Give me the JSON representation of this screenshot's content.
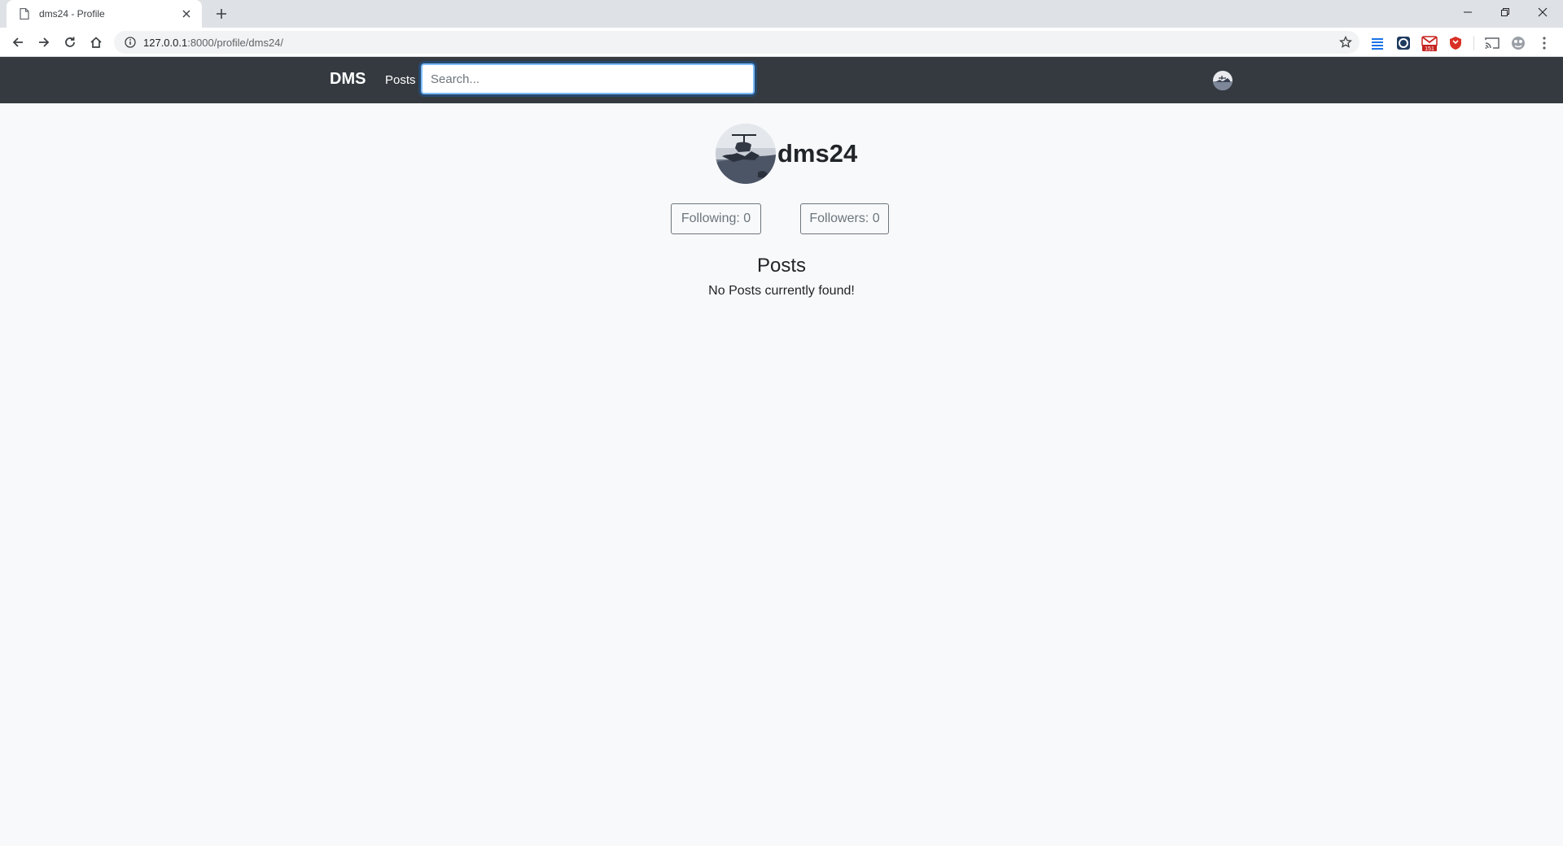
{
  "browser": {
    "tab_title": "dms24 - Profile",
    "url_host": "127.0.0.1",
    "url_path": ":8000/profile/dms24/"
  },
  "nav": {
    "brand": "DMS",
    "posts_link": "Posts",
    "search_placeholder": "Search..."
  },
  "profile": {
    "username": "dms24",
    "following_label": "Following: 0",
    "followers_label": "Followers: 0"
  },
  "posts": {
    "title": "Posts",
    "empty_message": "No Posts currently found!"
  },
  "colors": {
    "navbar": "#343a40",
    "page_bg": "#f8f9fa",
    "focus_ring": "#80bdff",
    "outline_secondary": "#6c757d"
  },
  "extensions": {
    "gmail_badge": "151"
  }
}
